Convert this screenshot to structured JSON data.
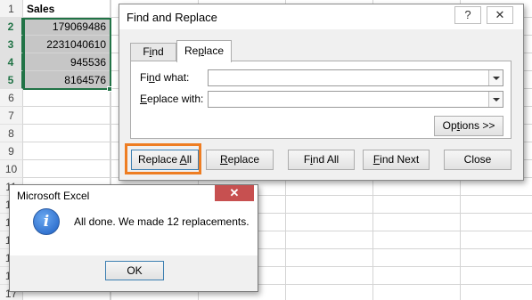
{
  "sheet": {
    "header": "Sales",
    "row_numbers": [
      "1",
      "2",
      "3",
      "4",
      "5",
      "6",
      "7",
      "8",
      "9",
      "10",
      "11",
      "12",
      "13",
      "14",
      "15",
      "16",
      "17"
    ],
    "values": [
      "179069486",
      "2231040610",
      "945536",
      "8164576"
    ]
  },
  "find_replace": {
    "title": "Find and Replace",
    "help_icon": "?",
    "close_icon": "✕",
    "tabs": [
      {
        "label_pre": "F",
        "label_u": "i",
        "label_post": "nd"
      },
      {
        "label_pre": "Re",
        "label_u": "p",
        "label_post": "lace"
      }
    ],
    "find_what": {
      "pre": "Fi",
      "u": "n",
      "post": "d what:",
      "value": ""
    },
    "replace_with": {
      "pre": "",
      "u": "E",
      "post": "eplace with:",
      "value": ""
    },
    "options_button": {
      "pre": "Op",
      "u": "t",
      "post": "ions >>"
    },
    "buttons": {
      "replace_all": {
        "pre": "Replace ",
        "u": "A",
        "post": "ll"
      },
      "replace": {
        "pre": "",
        "u": "R",
        "post": "eplace"
      },
      "find_all": {
        "pre": "F",
        "u": "i",
        "post": "nd All"
      },
      "find_next": {
        "pre": "",
        "u": "F",
        "post": "ind Next"
      },
      "close": "Close"
    },
    "highlight_color": "#ee7d22"
  },
  "message_box": {
    "title": "Microsoft Excel",
    "close_icon": "✕",
    "icon": "i",
    "text": "All done. We made 12 replacements.",
    "ok": "OK"
  },
  "colors": {
    "excel_green": "#217346",
    "selection_gray": "#c6c6c6",
    "close_red": "#c75050"
  }
}
